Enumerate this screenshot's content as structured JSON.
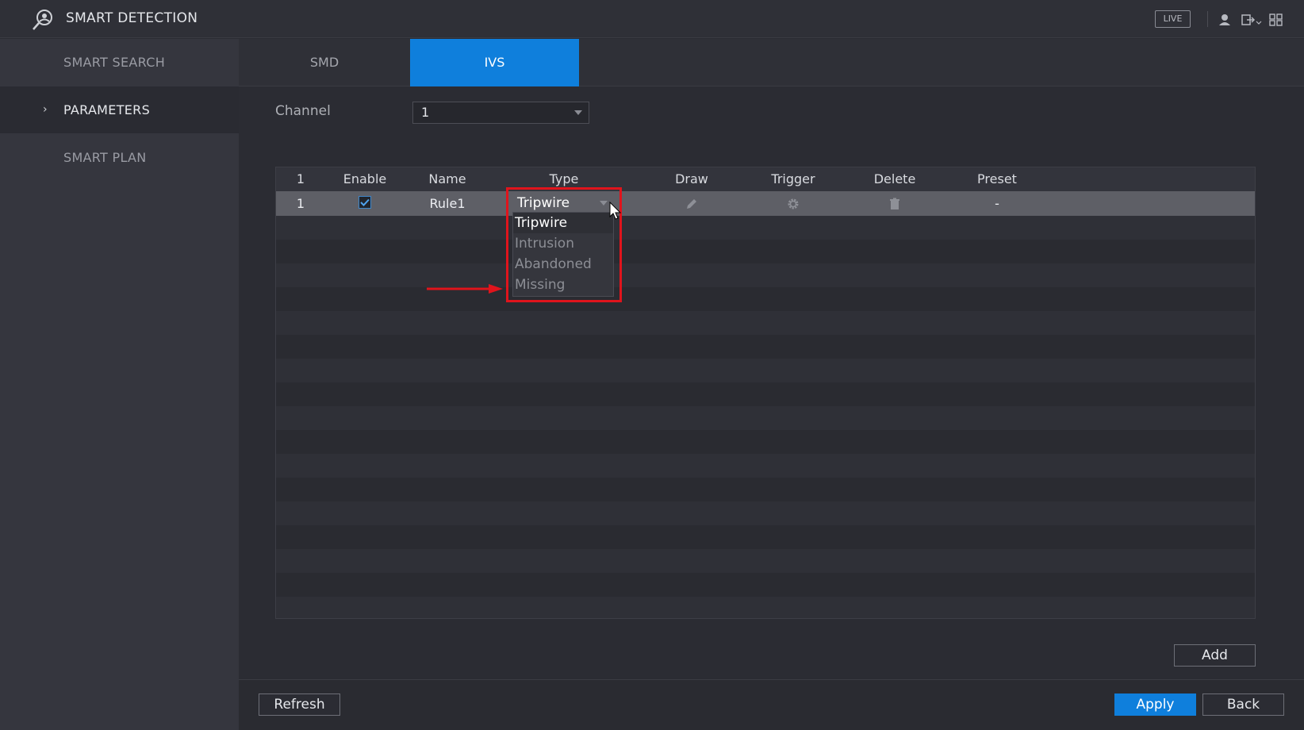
{
  "header": {
    "title": "SMART DETECTION",
    "live_label": "LIVE",
    "logo_icon": "smart-detection-icon",
    "right_icons": [
      "user-icon",
      "logout-icon",
      "grid-icon"
    ]
  },
  "sidebar": {
    "items": [
      {
        "label": "SMART SEARCH"
      },
      {
        "label": "PARAMETERS",
        "active": true,
        "chevron": "›"
      },
      {
        "label": "SMART PLAN"
      }
    ]
  },
  "tabs": [
    {
      "label": "SMD"
    },
    {
      "label": "IVS",
      "active": true
    }
  ],
  "channel": {
    "label": "Channel",
    "value": "1"
  },
  "table": {
    "headers": [
      "1",
      "Enable",
      "Name",
      "Type",
      "Draw",
      "Trigger",
      "Delete",
      "Preset"
    ],
    "rows": [
      {
        "index": "1",
        "enabled": true,
        "name": "Rule1",
        "type": "Tripwire",
        "draw_icon": "pencil-icon",
        "trigger_icon": "gear-icon",
        "delete_icon": "trash-icon",
        "preset": "-"
      }
    ]
  },
  "type_dropdown": {
    "selected": "Tripwire",
    "options": [
      "Tripwire",
      "Intrusion",
      "Abandoned",
      "Missing"
    ]
  },
  "buttons": {
    "add": "Add",
    "refresh": "Refresh",
    "apply": "Apply",
    "back": "Back"
  },
  "colors": {
    "accent": "#0f7fdc",
    "highlight": "#e0141c"
  }
}
